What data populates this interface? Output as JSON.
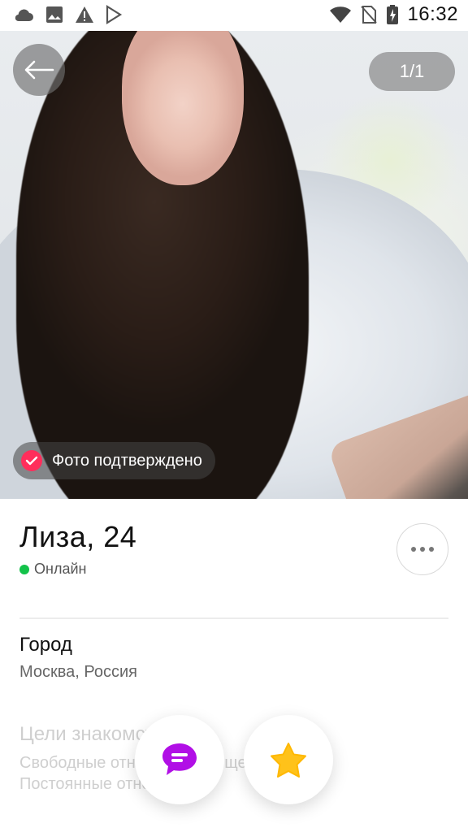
{
  "status_bar": {
    "time": "16:32",
    "left_icons": [
      "cloud-icon",
      "image-icon",
      "warning-icon",
      "play-store-icon"
    ],
    "right_icons": [
      "wifi-icon",
      "no-sim-icon",
      "battery-charging-icon"
    ]
  },
  "photo": {
    "counter": "1/1",
    "verified_label": "Фото подтверждено",
    "accent_color": "#ff2e5b"
  },
  "profile": {
    "name_age": "Лиза, 24",
    "status": "Онлайн",
    "status_color": "#13c24a"
  },
  "sections": {
    "city_title": "Город",
    "city_value": "Москва, Россия",
    "goals_title": "Цели знакомства",
    "goals_line1": "Свободные отношения, Общение,",
    "goals_line2": "Постоянные отношения"
  },
  "actions": {
    "chat_color": "#b10fe6",
    "star_color": "#ffc21a"
  }
}
